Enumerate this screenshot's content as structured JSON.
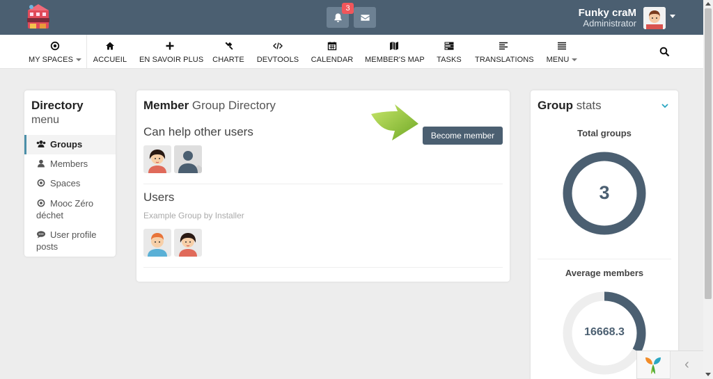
{
  "header": {
    "logo_icon": "le-village-logo",
    "notifications_badge": "3",
    "user_name": "Funky craM",
    "user_role": "Administrator"
  },
  "nav": {
    "items": [
      {
        "label": "MY SPACES",
        "icon": "dot-circle-icon"
      },
      {
        "label": "ACCUEIL",
        "icon": "home-icon"
      },
      {
        "label": "EN SAVOIR PLUS",
        "icon": "plus-icon"
      },
      {
        "label": "CHARTE",
        "icon": "gavel-icon"
      },
      {
        "label": "DEVTOOLS",
        "icon": "code-icon"
      },
      {
        "label": "CALENDAR",
        "icon": "calendar-icon"
      },
      {
        "label": "MEMBER'S MAP",
        "icon": "map-icon"
      },
      {
        "label": "TASKS",
        "icon": "tasks-icon"
      },
      {
        "label": "TRANSLATIONS",
        "icon": "align-left-icon"
      },
      {
        "label": "MENU",
        "icon": "bars-icon"
      }
    ]
  },
  "directory_menu": {
    "title": "Directory",
    "subtitle": "menu",
    "items": [
      {
        "label": "Groups",
        "icon": "users-icon"
      },
      {
        "label": "Members",
        "icon": "user-icon"
      },
      {
        "label": "Spaces",
        "icon": "dot-circle-icon"
      },
      {
        "label": "Mooc Zéro déchet",
        "icon": "dot-circle-icon"
      },
      {
        "label": "User profile posts",
        "icon": "comment-icon"
      }
    ]
  },
  "group_directory": {
    "title_bold": "Member",
    "title_rest": "Group Directory",
    "become_member_label": "Become member",
    "groups": [
      {
        "name": "Can help other users",
        "description": ""
      },
      {
        "name": "Users",
        "description": "Example Group by Installer"
      }
    ]
  },
  "group_stats": {
    "title_bold": "Group",
    "title_rest": "stats",
    "total_groups_label": "Total groups",
    "total_groups_value": "3",
    "total_groups_fill": 1.0,
    "average_members_label": "Average members",
    "average_members_value": "16668.3",
    "average_members_fill": 0.33
  },
  "colors": {
    "header_bg": "#4b5f71",
    "accent": "#4b8fa8",
    "badge": "#f0565b",
    "ring": "#4b5f71"
  }
}
